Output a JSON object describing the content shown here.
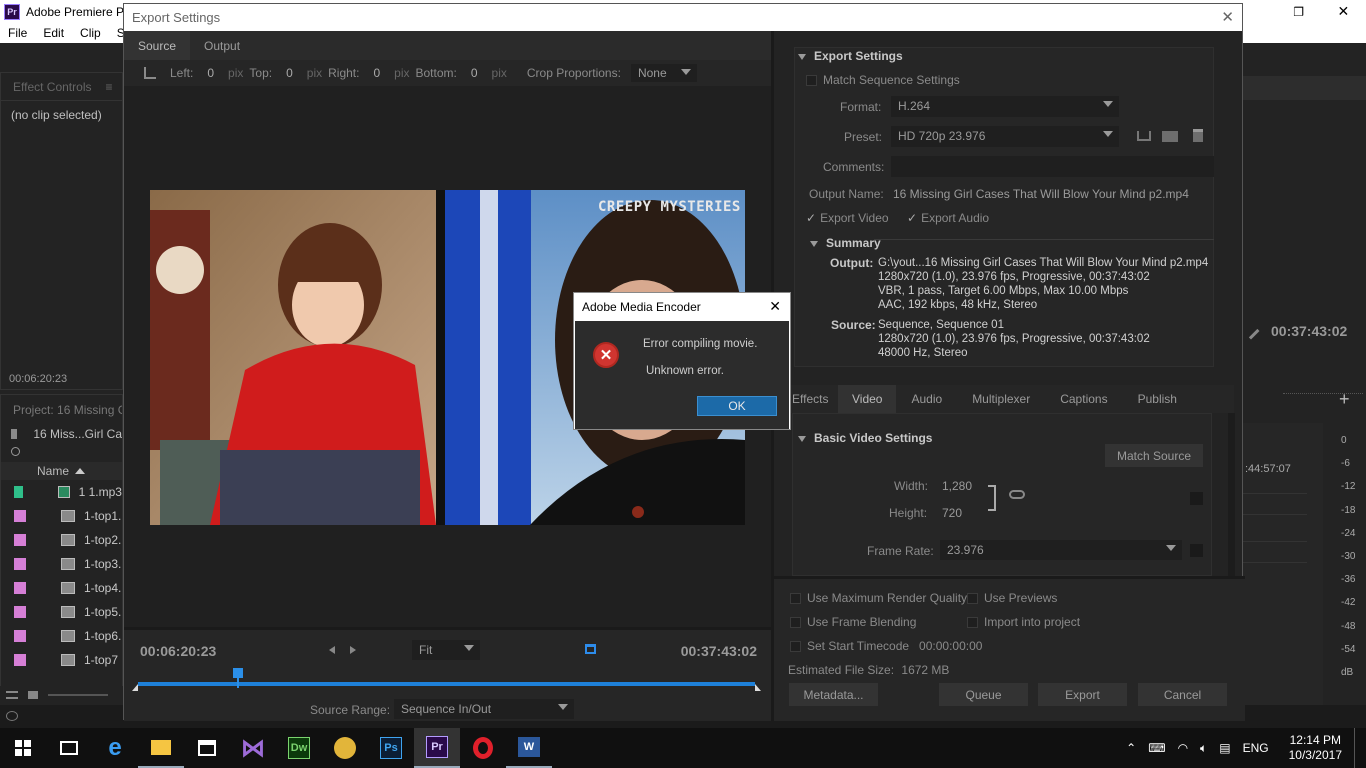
{
  "app": {
    "title": "Adobe Premiere Pr",
    "menu": [
      "File",
      "Edit",
      "Clip",
      "Se"
    ]
  },
  "effect_controls": {
    "tab": "Effect Controls",
    "menu_glyph": "≡",
    "no_clip": "(no clip selected)",
    "timecode": "00:06:20:23"
  },
  "project": {
    "label": "Project: 16 Missing G",
    "folder": "16 Miss...Girl Ca",
    "col_name": "Name",
    "items": [
      {
        "name": "1 1.mp3",
        "color": "#2fbf8a"
      },
      {
        "name": "1-top1.",
        "color": "#d57fd6"
      },
      {
        "name": "1-top2.",
        "color": "#d57fd6"
      },
      {
        "name": "1-top3.",
        "color": "#d57fd6"
      },
      {
        "name": "1-top4.",
        "color": "#d57fd6"
      },
      {
        "name": "1-top5.",
        "color": "#d57fd6"
      },
      {
        "name": "1-top6.",
        "color": "#d57fd6"
      },
      {
        "name": "1-top7",
        "color": "#d57fd6"
      }
    ]
  },
  "export": {
    "title": "Export Settings",
    "close": "✕",
    "tabs": {
      "source": "Source",
      "output": "Output"
    },
    "crop": {
      "left_label": "Left:",
      "left": "0",
      "top_label": "Top:",
      "top": "0",
      "right_label": "Right:",
      "right": "0",
      "bottom_label": "Bottom:",
      "bottom": "0",
      "pix": "pix",
      "proportions_label": "Crop Proportions:",
      "proportions": "None"
    },
    "video_watermark": "CREEPY MYSTERIES",
    "timeline": {
      "start": "00:06:20:23",
      "end": "00:37:43:02",
      "fit": "Fit",
      "source_range_label": "Source Range:",
      "source_range": "Sequence In/Out",
      "playhead_fraction": 0.162
    },
    "settings": {
      "header": "Export Settings",
      "match_seq": "Match Sequence Settings",
      "format_label": "Format:",
      "format": "H.264",
      "preset_label": "Preset:",
      "preset": "HD 720p 23.976",
      "comments_label": "Comments:",
      "output_name_label": "Output Name:",
      "output_name": "16 Missing Girl Cases That Will Blow Your Mind p2.mp4",
      "export_video": "Export Video",
      "export_audio": "Export Audio"
    },
    "summary": {
      "header": "Summary",
      "output_label": "Output:",
      "output_lines": [
        "G:\\yout...16 Missing Girl Cases That Will Blow Your Mind p2.mp4",
        "1280x720 (1.0), 23.976 fps, Progressive, 00:37:43:02",
        "VBR, 1 pass, Target 6.00 Mbps, Max 10.00 Mbps",
        "AAC, 192 kbps, 48 kHz, Stereo"
      ],
      "source_label": "Source:",
      "source_lines": [
        "Sequence, Sequence 01",
        "1280x720 (1.0), 23.976 fps, Progressive, 00:37:43:02",
        "48000 Hz, Stereo"
      ]
    },
    "out_tabs": [
      "Effects",
      "Video",
      "Audio",
      "Multiplexer",
      "Captions",
      "Publish"
    ],
    "basic_video": {
      "header": "Basic Video Settings",
      "match_source": "Match Source",
      "width_label": "Width:",
      "width": "1,280",
      "height_label": "Height:",
      "height": "720",
      "frame_rate_label": "Frame Rate:",
      "frame_rate": "23.976"
    },
    "bottom": {
      "max_render": "Use Maximum Render Quality",
      "use_previews": "Use Previews",
      "frame_blending": "Use Frame Blending",
      "import_project": "Import into project",
      "start_timecode_label": "Set Start Timecode",
      "start_timecode": "00:00:00:00",
      "est_size_label": "Estimated File Size:",
      "est_size": "1672 MB",
      "metadata": "Metadata...",
      "queue": "Queue",
      "export": "Export",
      "cancel": "Cancel"
    }
  },
  "dialog": {
    "title": "Adobe Media Encoder",
    "message": "Error compiling movie.",
    "detail": "Unknown error.",
    "ok": "OK"
  },
  "right_panel": {
    "timecode": "00:37:43:02",
    "seq_time": ":44:57:07",
    "meter": [
      "0",
      "-6",
      "-12",
      "-18",
      "-24",
      "-30",
      "-36",
      "-42",
      "-48",
      "-54",
      "dB"
    ]
  },
  "window_controls": {
    "restore": "❐",
    "close": "✕"
  },
  "taskbar": {
    "time": "12:14 PM",
    "date": "10/3/2017",
    "lang": "ENG"
  }
}
